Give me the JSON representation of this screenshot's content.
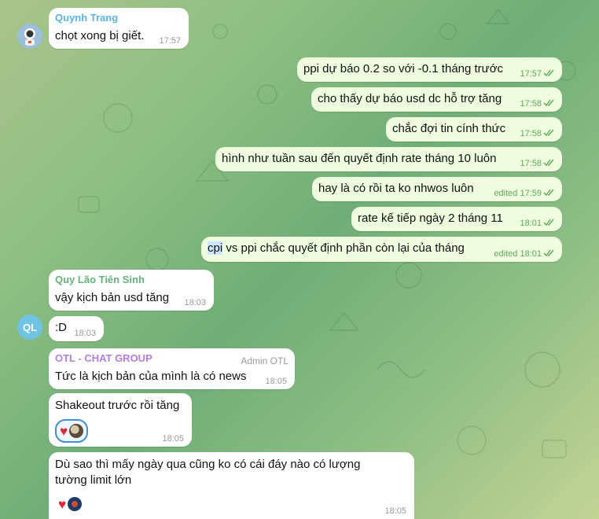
{
  "chat": {
    "m1": {
      "sender": "Quynh Trang",
      "sender_color": "#5bb3e8",
      "text": "chọt xong bị giết.",
      "time": "17:57"
    },
    "outgoing": [
      {
        "text": "ppi dự báo 0.2 so với -0.1 tháng trước",
        "time": "17:57"
      },
      {
        "text": "cho thấy dự báo usd dc hỗ trợ tăng",
        "time": "17:58"
      },
      {
        "text": "chắc đợi tin cính thức",
        "time": "17:58"
      },
      {
        "text": "hình như tuần sau đến quyết định rate tháng 10 luôn",
        "time": "17:58"
      },
      {
        "text": "hay là có rồi ta ko nhwos luôn",
        "time": "edited 17:59"
      },
      {
        "text": "rate kế tiếp ngày 2 tháng 11",
        "time": "18:01"
      },
      {
        "text_highlight": "cpi",
        "text_rest": " vs ppi chắc quyết định phần còn lại của tháng",
        "time": "edited 18:01"
      }
    ],
    "m9": {
      "sender": "Quy Lão Tiên Sinh",
      "sender_color": "#63b37a",
      "text": "vậy kịch bản usd tăng",
      "time": "18:03"
    },
    "m10": {
      "avatar_initials": "QL",
      "avatar_color": "#6fc3e3",
      "text": ":D",
      "time": "18:03"
    },
    "m11": {
      "sender": "OTL - CHAT GROUP",
      "sender_color": "#b27fe0",
      "role": "Admin OTL",
      "text": "Tức là kịch bản của mình là có news",
      "time": "18:05"
    },
    "m12": {
      "text": "Shakeout trước rồi tăng",
      "time": "18:05"
    },
    "m13": {
      "text_line1": "Dù sao thì mấy ngày qua cũng ko có cái đáy nào có lượng",
      "text_line2": "tường limit lớn",
      "time": "18:05"
    }
  },
  "icons": {
    "check": "double-check-icon",
    "heart": "heart-reaction-icon",
    "react_avatar": "reactor-avatar"
  },
  "colors": {
    "outgoing_bubble": "#effdde",
    "incoming_bubble": "#ffffff",
    "accent": "#3f8fd3"
  }
}
